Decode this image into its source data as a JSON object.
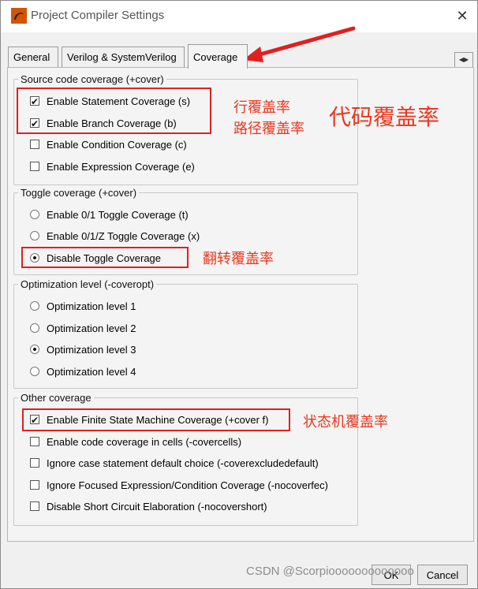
{
  "window": {
    "title": "Project Compiler Settings",
    "close_glyph": "✕"
  },
  "tabs": [
    {
      "label": "General"
    },
    {
      "label": "Verilog & SystemVerilog"
    },
    {
      "label": "Coverage"
    }
  ],
  "tab_scroll_glyph": "◀▶",
  "groups": {
    "source": {
      "legend": "Source code coverage (+cover)",
      "items": [
        {
          "label": "Enable Statement Coverage (s)",
          "checked": true
        },
        {
          "label": "Enable Branch Coverage (b)",
          "checked": true
        },
        {
          "label": "Enable Condition Coverage (c)",
          "checked": false
        },
        {
          "label": "Enable Expression Coverage (e)",
          "checked": false
        }
      ]
    },
    "toggle": {
      "legend": "Toggle coverage (+cover)",
      "items": [
        {
          "label": "Enable 0/1 Toggle Coverage (t)",
          "checked": false
        },
        {
          "label": "Enable 0/1/Z Toggle Coverage (x)",
          "checked": false
        },
        {
          "label": "Disable Toggle Coverage",
          "checked": true
        }
      ]
    },
    "optimization": {
      "legend": "Optimization level (-coveropt)",
      "items": [
        {
          "label": "Optimization level 1",
          "checked": false
        },
        {
          "label": "Optimization level 2",
          "checked": false
        },
        {
          "label": "Optimization level 3",
          "checked": true
        },
        {
          "label": "Optimization level 4",
          "checked": false
        }
      ]
    },
    "other": {
      "legend": "Other coverage",
      "items": [
        {
          "label": "Enable Finite State Machine Coverage (+cover f)",
          "checked": true
        },
        {
          "label": "Enable code coverage in cells (-covercells)",
          "checked": false
        },
        {
          "label": "Ignore case statement default choice (-coverexcludedefault)",
          "checked": false
        },
        {
          "label": "Ignore Focused Expression/Condition Coverage (-nocoverfec)",
          "checked": false
        },
        {
          "label": "Disable Short Circuit Elaboration (-nocovershort)",
          "checked": false
        }
      ]
    }
  },
  "annotations": {
    "statement": "行覆盖率",
    "branch": "路径覆盖率",
    "code": "代码覆盖率",
    "toggle": "翻转覆盖率",
    "fsm": "状态机覆盖率"
  },
  "buttons": {
    "ok": "OK",
    "cancel": "Cancel"
  },
  "watermark": "CSDN @Scorpiooooooooooooo",
  "colors": {
    "annotation_red": "#e02020",
    "annotation_text": "#e83820"
  }
}
